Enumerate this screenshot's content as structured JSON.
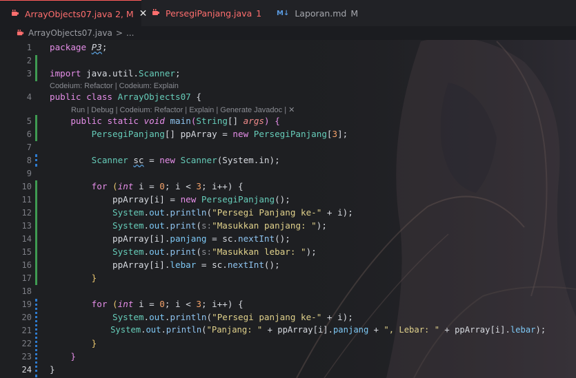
{
  "tabs": [
    {
      "icon": "java-icon",
      "label": "ArrayObjects07.java",
      "badge": "2, M",
      "active": true,
      "color": "#ff6e6e"
    },
    {
      "icon": "java-icon",
      "label": "PersegiPanjang.java",
      "badge": "1",
      "active": false,
      "color": "#ff6e6e"
    },
    {
      "icon": "markdown-icon",
      "label": "Laporan.md",
      "badge": "M",
      "active": false,
      "color": "#a5a7ad"
    }
  ],
  "tab_close": "✕",
  "markdown_glyph": "M↓",
  "breadcrumb": {
    "file": "ArrayObjects07.java",
    "sep": ">",
    "more": "..."
  },
  "line_numbers": [
    "1",
    "2",
    "3",
    "4",
    "5",
    "6",
    "7",
    "8",
    "9",
    "10",
    "11",
    "12",
    "13",
    "14",
    "15",
    "16",
    "17",
    "18",
    "19",
    "20",
    "21",
    "22",
    "23",
    "24"
  ],
  "codelens": {
    "class": "Codeium: Refactor | Codeium: Explain",
    "method": "Run | Debug | Codeium: Refactor | Explain | Generate Javadoc | ✕"
  },
  "code": {
    "l1_kw": "package",
    "l1_pkg": "P3",
    "l1_end": ";",
    "l3_kw": "import",
    "l3_path": "java.util.",
    "l3_cls": "Scanner",
    "l3_end": ";",
    "l4_kw1": "public",
    "l4_kw2": "class",
    "l4_name": "ArrayObjects07",
    "l4_end": "{",
    "l5_kw1": "public",
    "l5_kw2": "static",
    "l5_void": "void",
    "l5_fn": "main",
    "l5_p1": "(",
    "l5_type": "String",
    "l5_arr": "[]",
    "l5_arg": "args",
    "l5_p2": ")",
    "l5_end": "{",
    "l6_type": "PersegiPanjang",
    "l6_mid": "[] ppArray = ",
    "l6_new": "new",
    "l6_type2": "PersegiPanjang",
    "l6_idx1": "[",
    "l6_num": "3",
    "l6_idx2": "];",
    "l8_type": "Scanner",
    "l8_var": "sc",
    "l8_mid": " = ",
    "l8_new": "new",
    "l8_type2": "Scanner",
    "l8_args": "(System.in);",
    "l10_for": "for",
    "l10_p": "(",
    "l10_int": "int",
    "l10_rest1": " i = ",
    "l10_n0": "0",
    "l10_rest2": "; i < ",
    "l10_n3": "3",
    "l10_rest3": "; i++) {",
    "l11_a": "ppArray",
    "l11_b": "[i] = ",
    "l11_new": "new",
    "l11_type": "PersegiPanjang",
    "l11_end": "();",
    "l12_sys": "System",
    "l12_out": "out",
    "l12_fn": "println",
    "l12_str": "\"Persegi Panjang ke-\"",
    "l12_end": " + i);",
    "l13_sys": "System",
    "l13_out": "out",
    "l13_fn": "print",
    "l13_hint": "s:",
    "l13_str": "\"Masukkan panjang: \"",
    "l13_end": ");",
    "l14_a": "ppArray[i].",
    "l14_f": "panjang",
    "l14_b": " = sc.",
    "l14_fn": "nextInt",
    "l14_end": "();",
    "l15_sys": "System",
    "l15_out": "out",
    "l15_fn": "print",
    "l15_hint": "s:",
    "l15_str": "\"Masukkan lebar: \"",
    "l15_end": ");",
    "l16_a": "ppArray[i].",
    "l16_f": "lebar",
    "l16_b": " = sc.",
    "l16_fn": "nextInt",
    "l16_end": "();",
    "l17": "}",
    "l19_for": "for",
    "l19_p": "(",
    "l19_int": "int",
    "l19_rest1": " i = ",
    "l19_n0": "0",
    "l19_rest2": "; i < ",
    "l19_n3": "3",
    "l19_rest3": "; i++) {",
    "l20_sys": "System",
    "l20_out": "out",
    "l20_fn": "println",
    "l20_str": "\"Persegi panjang ke-\"",
    "l20_end": " + i);",
    "l21_sys": "System",
    "l21_out": "out",
    "l21_fn": "println",
    "l21_str1": "\"Panjang: \"",
    "l21_m1": " + ppArray[i].",
    "l21_f1": "panjang",
    "l21_m2": " + ",
    "l21_str2": "\", Lebar: \"",
    "l21_m3": " + ppArray[i].",
    "l21_f2": "lebar",
    "l21_end": ");",
    "l22": "}",
    "l23": "}",
    "l24": "}"
  }
}
